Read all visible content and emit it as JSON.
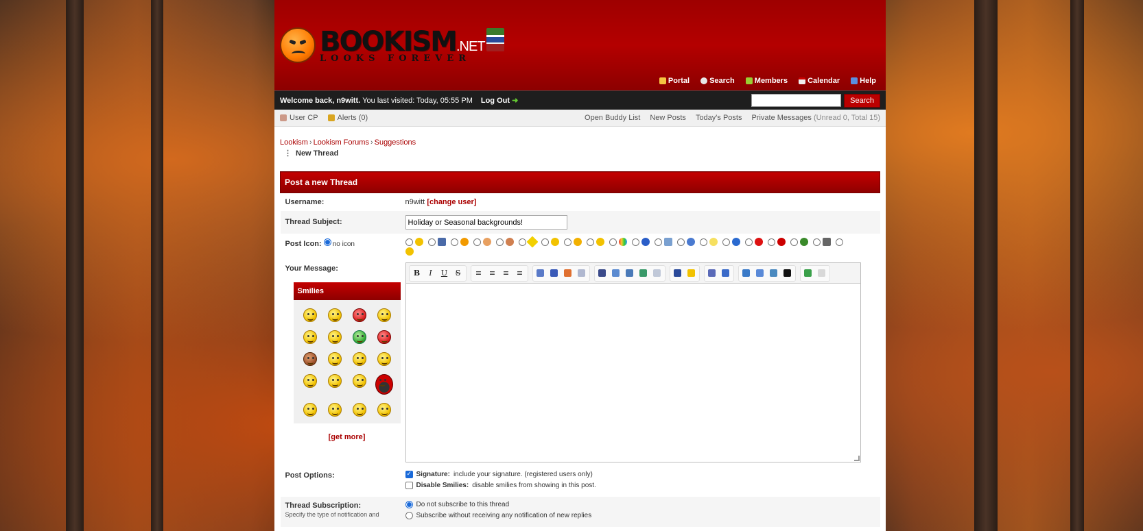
{
  "header": {
    "logo_main": "BOOKISM",
    "logo_net": ".NET",
    "logo_sub": "LOOKS FOREVER",
    "nav": [
      {
        "label": "Portal",
        "icon": "bell-icon",
        "color": "#f5c542"
      },
      {
        "label": "Search",
        "icon": "magnifier-icon",
        "color": "#e8e8e8"
      },
      {
        "label": "Members",
        "icon": "members-icon",
        "color": "#9acd32"
      },
      {
        "label": "Calendar",
        "icon": "calendar-icon",
        "color": "#f0f0f0"
      },
      {
        "label": "Help",
        "icon": "help-icon",
        "color": "#5b8fe0"
      }
    ]
  },
  "welcome": {
    "greeting": "Welcome back, n9witt.",
    "last_visited": "You last visited: Today, 05:55 PM",
    "logout": "Log Out",
    "search_value": "",
    "search_button": "Search"
  },
  "panel": {
    "user_cp": "User CP",
    "alerts": "Alerts (0)",
    "links": [
      "Open Buddy List",
      "New Posts",
      "Today's Posts"
    ],
    "pm_label": "Private Messages",
    "pm_counts": "(Unread 0, Total 15)"
  },
  "breadcrumb": {
    "items": [
      "Lookism",
      "Lookism Forums",
      "Suggestions"
    ],
    "current": "New Thread"
  },
  "form": {
    "title": "Post a new Thread",
    "username_label": "Username:",
    "username_value": "n9witt",
    "change_user": "[change user]",
    "subject_label": "Thread Subject:",
    "subject_value": "Holiday or Seasonal backgrounds!",
    "post_icon_label": "Post Icon:",
    "no_icon": "no icon",
    "message_label": "Your Message:",
    "smilies_title": "Smilies",
    "get_more": "[get more]",
    "post_options_label": "Post Options:",
    "signature_label": "Signature:",
    "signature_desc": "include your signature. (registered users only)",
    "disable_smilies_label": "Disable Smilies:",
    "disable_smilies_desc": "disable smilies from showing in this post.",
    "subscription_label": "Thread Subscription:",
    "subscription_desc": "Specify the type of notification and",
    "sub_opt1": "Do not subscribe to this thread",
    "sub_opt2": "Subscribe without receiving any notification of new replies"
  },
  "toolbar": {
    "bold": "B",
    "italic": "I",
    "underline": "U",
    "strike": "S"
  }
}
